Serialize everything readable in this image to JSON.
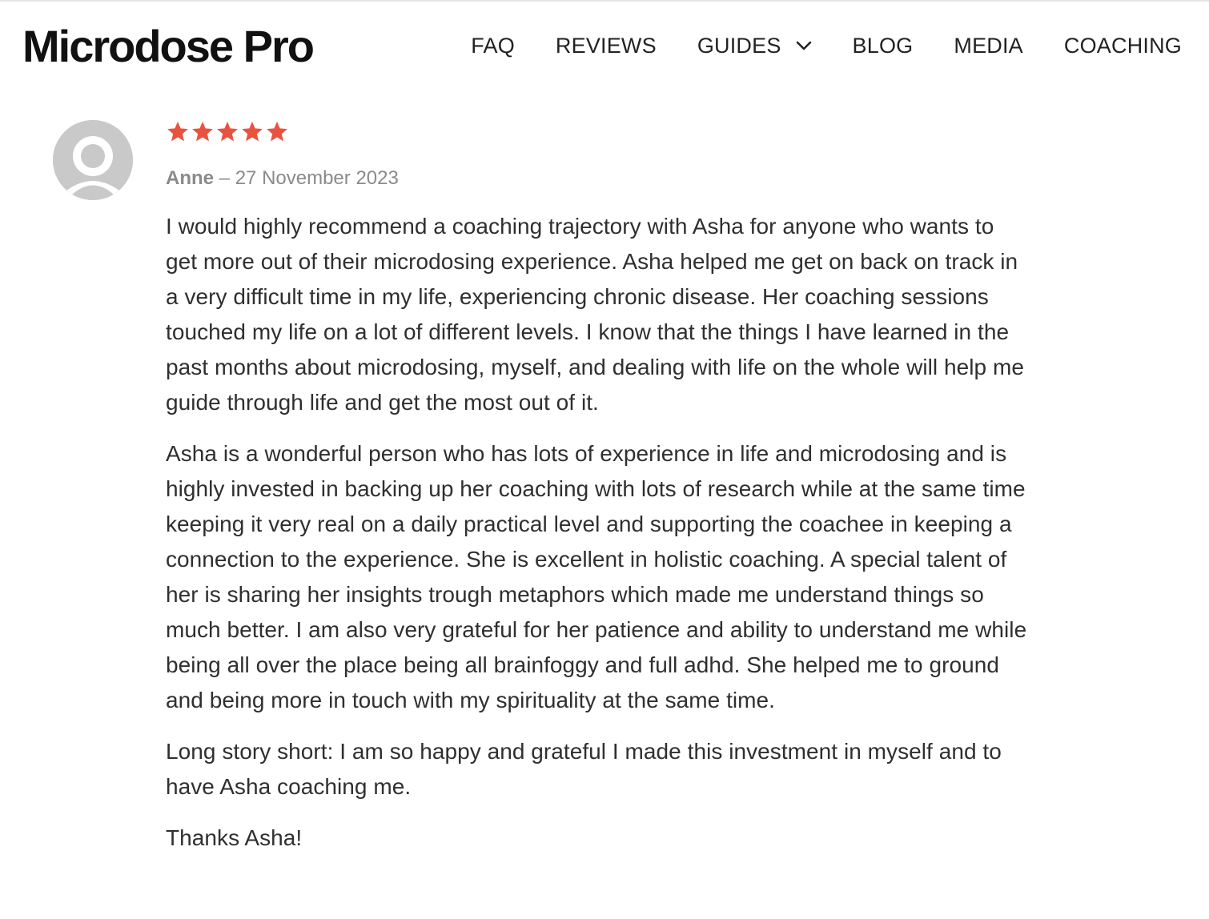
{
  "header": {
    "logo": "Microdose Pro",
    "nav": [
      {
        "label": "FAQ"
      },
      {
        "label": "REVIEWS"
      },
      {
        "label": "GUIDES",
        "has_dropdown": true,
        "icon": "chevron-down-icon"
      },
      {
        "label": "BLOG"
      },
      {
        "label": "MEDIA"
      },
      {
        "label": "COACHING"
      }
    ]
  },
  "review": {
    "avatar_icon": "default-user-avatar-icon",
    "rating": 5,
    "rating_max": 5,
    "star_color": "#e8533f",
    "author": "Anne",
    "separator": "–",
    "date": "27 November 2023",
    "paragraphs": [
      "I would highly recommend a coaching trajectory with Asha for anyone who wants to get more out of their microdosing experience. Asha helped me get on back on track in a very difficult time in my life, experiencing chronic disease. Her coaching sessions touched my life on a lot of different levels. I know that the things I have learned in the past months about microdosing, myself, and dealing with life on the whole will help me guide through life and get the most out of it.",
      "Asha is a wonderful person who has lots of experience in life and microdosing and is highly invested in backing up her coaching with lots of research while at the same time keeping it very real on a daily practical level and supporting the coachee in keeping a connection to the experience. She is excellent in holistic coaching. A special talent of her is sharing her insights trough metaphors which made me understand things so much better. I am also very grateful for her patience and ability to understand me while being all over the place being all brainfoggy and full adhd. She helped me to ground and being more in touch with my spirituality at the same time.",
      "Long story short: I am so happy and grateful I made this investment in myself and to have Asha coaching me.",
      "Thanks Asha!"
    ]
  }
}
